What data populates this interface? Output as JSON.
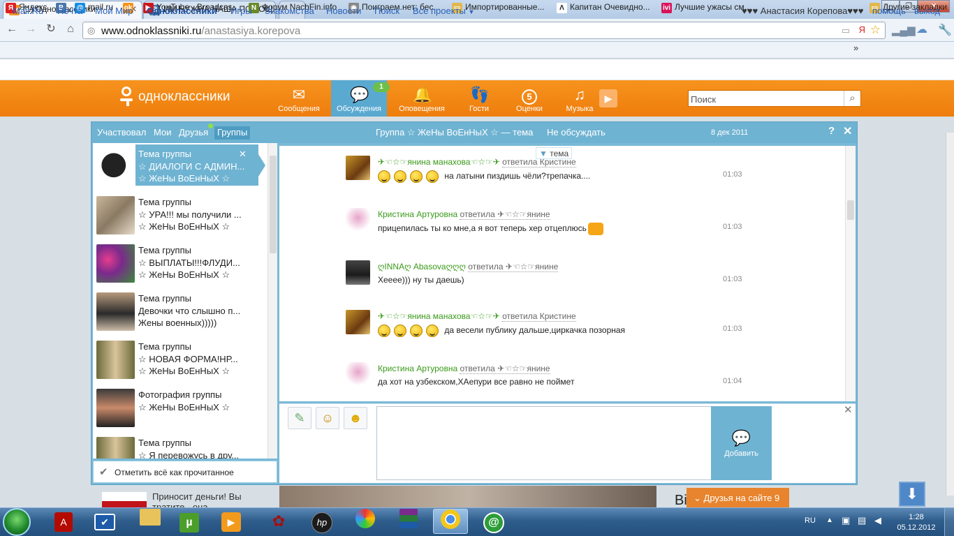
{
  "browser": {
    "tabs": [
      {
        "label": "(1) Одноклассники",
        "icon": "odnoklassniki-favicon",
        "active": true
      },
      {
        "label": "ИМ НУЖНА НАША ПОМОЩ",
        "icon": "vk-favicon",
        "active": false
      }
    ],
    "url_host": "www.odnoklassniki.ru",
    "url_path": "/anastasiya.korepova",
    "bookmarks": [
      {
        "label": "Яндекс",
        "icon": "yandex-icon",
        "color": "#e02020"
      },
      {
        "label": "",
        "icon": "vk-icon",
        "color": "#4a76a8"
      },
      {
        "label": "mail.ru",
        "icon": "mailru-icon",
        "color": "#168de2"
      },
      {
        "label": "",
        "icon": "odnoklassniki-icon",
        "color": "#f7931e"
      },
      {
        "label": "YouTube - Broadcas...",
        "icon": "youtube-icon",
        "color": "#cc181e"
      },
      {
        "label": "Форум NachFin.info",
        "icon": "nachfin-icon",
        "color": "#6a8a2a"
      },
      {
        "label": "Поиграем.нет: бес...",
        "icon": "game-icon",
        "color": "#888"
      },
      {
        "label": "Импортированные...",
        "icon": "folder-icon",
        "color": "#e0b84e"
      },
      {
        "label": "Капитан Очевидно...",
        "icon": "lambda-icon",
        "color": "#222"
      },
      {
        "label": "Лучшие ужасы см...",
        "icon": "ivi-icon",
        "color": "#d8155a"
      }
    ],
    "other_bookmarks": "Другие закладки",
    "more": "»"
  },
  "portal": {
    "links": [
      "Mail.Ru",
      "Почта",
      "Мой Мир",
      "Одноклассники",
      "Игры",
      "Знакомства",
      "Новости",
      "Поиск",
      "Все проекты"
    ],
    "user": "♥♥♥ Анастасия Корепова♥♥♥",
    "help": "помощь",
    "logout": "выход"
  },
  "ok_header": {
    "logo": "одноклассники",
    "nav": [
      {
        "label": "Сообщения",
        "icon": "envelope-icon",
        "badge": ""
      },
      {
        "label": "Обсуждения",
        "icon": "chat-bubbles-icon",
        "badge": "1"
      },
      {
        "label": "Оповещения",
        "icon": "bell-icon",
        "badge": ""
      },
      {
        "label": "Гости",
        "icon": "footprints-icon",
        "badge": ""
      },
      {
        "label": "Оценки",
        "icon": "rating-icon",
        "badge": "5"
      },
      {
        "label": "Музыка",
        "icon": "music-note-icon",
        "badge": ""
      }
    ],
    "search_placeholder": "Поиск"
  },
  "dialog": {
    "filter_tabs": [
      "Участвовал",
      "Мои",
      "Друзья",
      "Группы"
    ],
    "active_filter": "Группы",
    "title": "Группа ☆ ЖеНы ВоЕнНыХ ☆ — тема",
    "not_discuss": "Не обсуждать",
    "date": "8 дек 2011",
    "help": "?",
    "close": "✕",
    "topics": [
      {
        "kind": "Тема группы",
        "title": "☆ ДИАЛОГИ С АДМИН...",
        "group": "☆ ЖеНы ВоЕнНыХ ☆"
      },
      {
        "kind": "Тема группы",
        "title": "☆ УРА!!! мы получили ...",
        "group": "☆ ЖеНы ВоЕнНыХ ☆"
      },
      {
        "kind": "Тема группы",
        "title": "☆ ВЫПЛАТЫ!!!ФЛУДИ...",
        "group": "☆ ЖеНы ВоЕнНыХ ☆"
      },
      {
        "kind": "Тема группы",
        "title": "Девочки что слышно п...",
        "group": "Жены военных)))))"
      },
      {
        "kind": "Тема группы",
        "title": "☆ НОВАЯ ФОРМА!НР...",
        "group": "☆ ЖеНы ВоЕнНыХ ☆"
      },
      {
        "kind": "Фотография группы",
        "title": "☆ ЖеНы ВоЕнНыХ ☆",
        "group": ""
      },
      {
        "kind": "Тема группы",
        "title": "☆ Я перевожусь в дру...",
        "group": ""
      }
    ],
    "mark_read": "Отметить всё как прочитанное",
    "topic_chip": "тема",
    "messages": [
      {
        "author": "✈☜☆☞янина манахова☜☆☞✈",
        "reply": "ответила Кристине",
        "text": "на латыни пиздишь чёли?трепачка....",
        "smiles": 4,
        "time": "01:03"
      },
      {
        "author": "Кристина Артуровна",
        "reply": "ответила ✈☜☆☞янине",
        "text": "прицепилась ты ко мне,а я вот теперь хер отцеплюсь",
        "smiles": 0,
        "time": "01:03"
      },
      {
        "author": "ღINNAღ Abasovaღღღ",
        "reply": "ответила ✈☜☆☞янине",
        "text": "Хееее))) ну ты даешь)",
        "smiles": 0,
        "time": "01:03"
      },
      {
        "author": "✈☜☆☞янина манахова☜☆☞✈",
        "reply": "ответила Кристине",
        "text": "да весели публику дальше,циркачка позорная",
        "smiles": 4,
        "time": "01:03"
      },
      {
        "author": "Кристина Артуровна",
        "reply": "ответила ✈☜☆☞янине",
        "text": "да хот на узбекском,ХАепури все равно не поймет",
        "smiles": 0,
        "time": "01:04"
      }
    ],
    "send_label": "Добавить"
  },
  "page_below": {
    "promo": "Приносит деньги! Вы",
    "promo2": "тратите - она",
    "friends": "Друзья на сайте 9",
    "v_text": "Ві"
  },
  "taskbar": {
    "lang": "RU",
    "time": "1:28",
    "date": "05.12.2012"
  },
  "colors": {
    "ok_orange": "#f7931e",
    "dialog_blue": "#6fb3d2",
    "link_blue": "#2a62b8",
    "author_green": "#3a9a1a"
  }
}
